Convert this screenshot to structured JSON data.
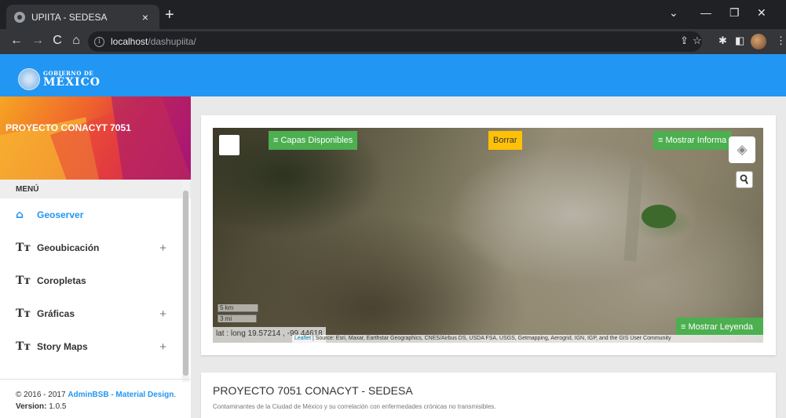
{
  "browser": {
    "tab_title": "UPIITA - SEDESA",
    "tab_close": "×",
    "new_tab": "+",
    "url_host": "localhost",
    "url_path": "/dashupiita/",
    "icons": [
      "back-icon",
      "forward-icon",
      "reload-icon",
      "home-icon",
      "info-icon",
      "share-icon",
      "star-icon",
      "extensions-icon",
      "sidepanel-icon",
      "profile-avatar",
      "menu-icon"
    ]
  },
  "header": {
    "logo_small": "GOBIERNO DE",
    "logo_big": "MÉXICO",
    "color": "#2196f3"
  },
  "sidebar": {
    "banner_title": "PROYECTO CONACYT 7051",
    "menu_heading": "MENÚ",
    "items": [
      {
        "label": "Geoserver",
        "icon": "home-icon",
        "active": true
      },
      {
        "label": "Geoubicación",
        "icon": "text-size-icon",
        "expand": "+"
      },
      {
        "label": "Coropletas",
        "icon": "text-size-icon"
      },
      {
        "label": "Gráficas",
        "icon": "text-size-icon",
        "expand": "+"
      },
      {
        "label": "Story Maps",
        "icon": "text-size-icon",
        "expand": "+"
      }
    ],
    "footer_copyright": "© 2016 - 2017 ",
    "footer_brand": "AdminBSB - Material Design",
    "footer_dot": ".",
    "version_label": "Version:",
    "version_value": " 1.0.5"
  },
  "map": {
    "layers_button": "≡ Capas Disponibles",
    "clear_button": "Borrar",
    "info_button": "≡ Mostrar Informa",
    "legend_button": "≡ Mostrar Leyenda",
    "scale_km": "5 km",
    "scale_mi": "3 mi",
    "coords": "lat : long 19.57214 , -99.44618",
    "attribution_link": "Leaflet",
    "attribution_text": " | Source: Esri, Maxar, Earthstar Geographics, CNES/Airbus DS, USDA FSA, USGS, Getmapping, Aerogrid, IGN, IGP, and the GIS User Community"
  },
  "info": {
    "title": "PROYECTO 7051 CONACYT - SEDESA",
    "subtitle": "Contaminantes de la Ciudad de México y su correlación con enfermedades crónicas no transmisibles."
  }
}
